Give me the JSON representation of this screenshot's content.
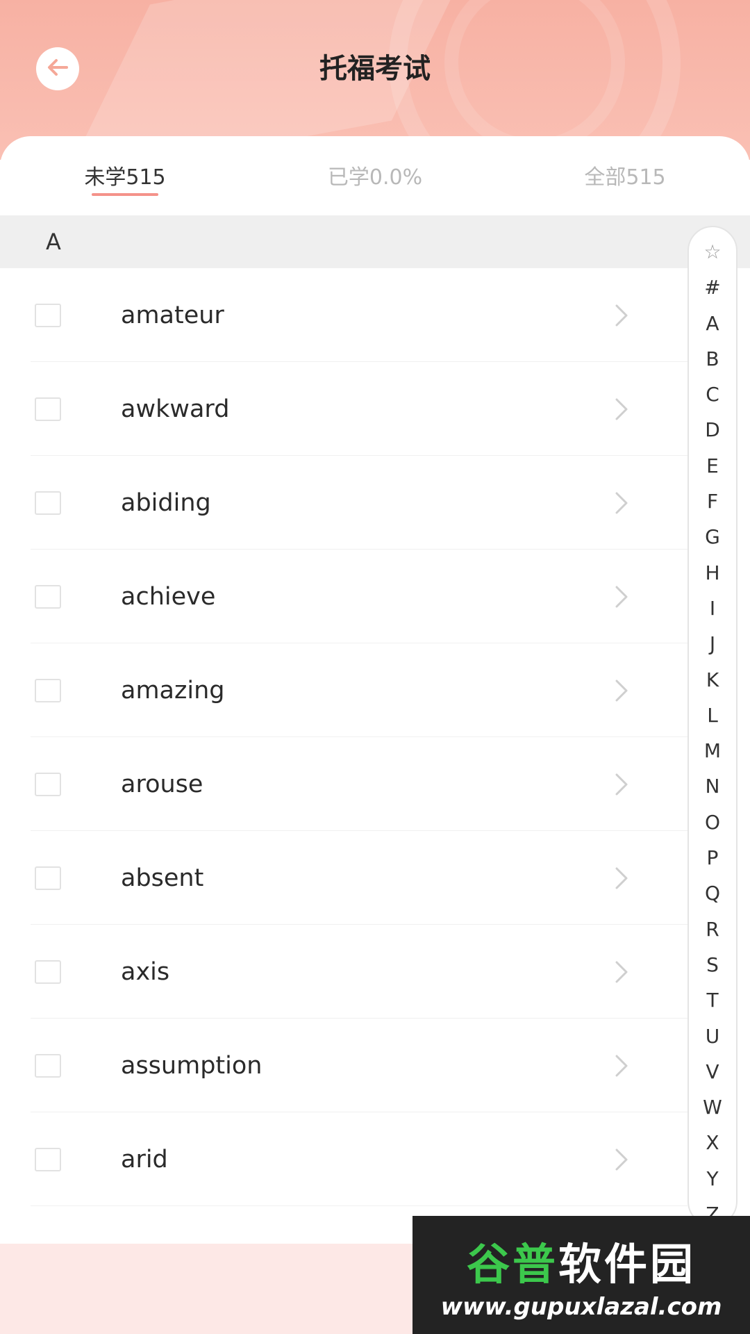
{
  "header": {
    "title": "托福考试",
    "back_icon": "arrow-left-icon"
  },
  "tabs": [
    {
      "label": "未学515",
      "active": true
    },
    {
      "label": "已学0.0%",
      "active": false
    },
    {
      "label": "全部515",
      "active": false
    }
  ],
  "section": {
    "letter": "A"
  },
  "words": [
    {
      "word": "amateur",
      "checked": false
    },
    {
      "word": "awkward",
      "checked": false
    },
    {
      "word": "abiding",
      "checked": false
    },
    {
      "word": "achieve",
      "checked": false
    },
    {
      "word": "amazing",
      "checked": false
    },
    {
      "word": "arouse",
      "checked": false
    },
    {
      "word": "absent",
      "checked": false
    },
    {
      "word": "axis",
      "checked": false
    },
    {
      "word": "assumption",
      "checked": false
    },
    {
      "word": "arid",
      "checked": false
    }
  ],
  "alphabet_index": [
    "☆",
    "#",
    "A",
    "B",
    "C",
    "D",
    "E",
    "F",
    "G",
    "H",
    "I",
    "J",
    "K",
    "L",
    "M",
    "N",
    "O",
    "P",
    "Q",
    "R",
    "S",
    "T",
    "U",
    "V",
    "W",
    "X",
    "Y",
    "Z"
  ],
  "watermark": {
    "brand_green": "谷普",
    "brand_white": "软件园",
    "url": "www.gupuxlazal.com"
  },
  "colors": {
    "header_pink": "#f7b1a3",
    "tab_underline": "#f4928a",
    "bottom_bar": "#fde8e6"
  }
}
